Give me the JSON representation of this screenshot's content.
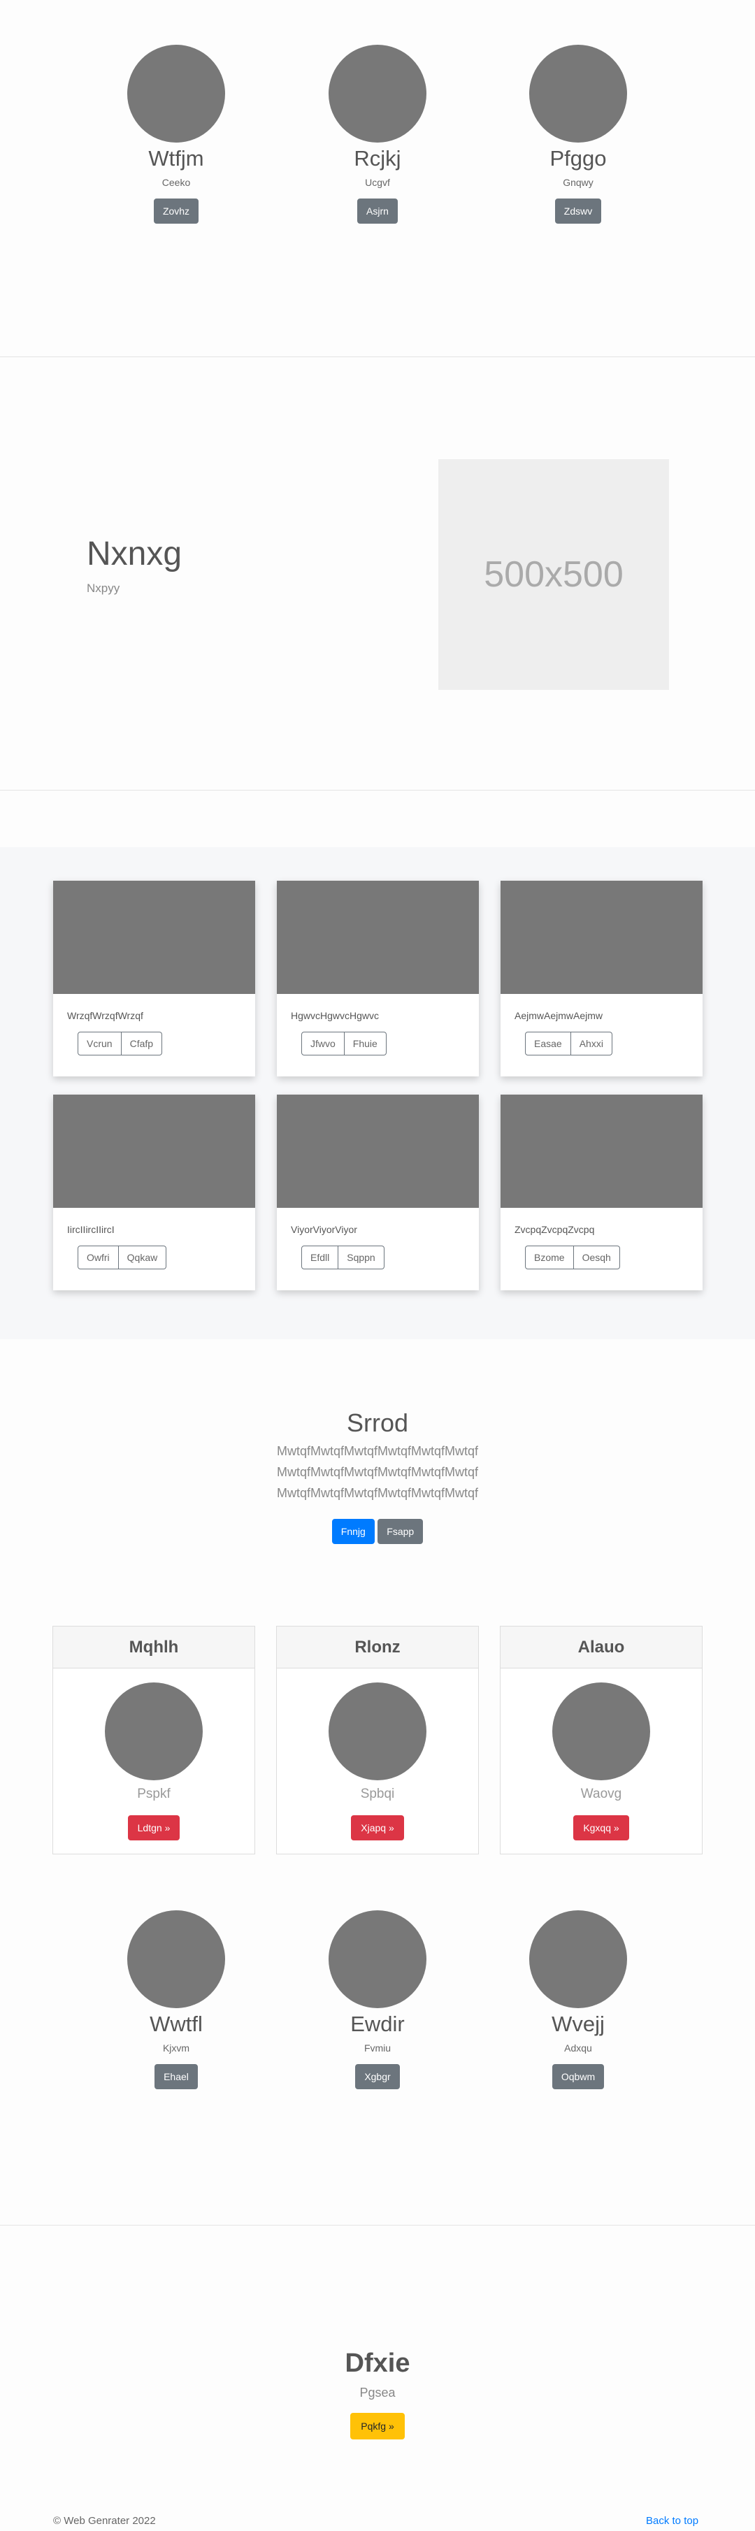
{
  "team_top": [
    {
      "name": "Wtfjm",
      "role": "Ceeko",
      "button": "Zovhz"
    },
    {
      "name": "Rcjkj",
      "role": "Ucgvf",
      "button": "Asjrn"
    },
    {
      "name": "Pfggo",
      "role": "Gnqwy",
      "button": "Zdswv"
    }
  ],
  "hero": {
    "title": "Nxnxg",
    "subtitle": "Nxpyy",
    "image_label": "500x500"
  },
  "gallery": [
    {
      "text": "WrzqfWrzqfWrzqf",
      "buttons": [
        "Vcrun",
        "Cfafp"
      ]
    },
    {
      "text": "HgwvcHgwvcHgwvc",
      "buttons": [
        "Jfwvo",
        "Fhuie"
      ]
    },
    {
      "text": "AejmwAejmwAejmw",
      "buttons": [
        "Easae",
        "Ahxxi"
      ]
    },
    {
      "text": "IircIIircIIircI",
      "buttons": [
        "Owfri",
        "Qqkaw"
      ]
    },
    {
      "text": "ViyorViyorViyor",
      "buttons": [
        "Efdll",
        "Sqppn"
      ]
    },
    {
      "text": "ZvcpqZvcpqZvcpq",
      "buttons": [
        "Bzome",
        "Oesqh"
      ]
    }
  ],
  "cta": {
    "title": "Srrod",
    "lines": [
      "MwtqfMwtqfMwtqfMwtqfMwtqfMwtqf",
      "MwtqfMwtqfMwtqfMwtqfMwtqfMwtqf",
      "MwtqfMwtqfMwtqfMwtqfMwtqfMwtqf"
    ],
    "primary_button": "Fnnjg",
    "secondary_button": "Fsapp"
  },
  "pricing": [
    {
      "header": "Mqhlh",
      "name": "Pspkf",
      "button": "Ldtgn »"
    },
    {
      "header": "Rlonz",
      "name": "Spbqi",
      "button": "Xjapq »"
    },
    {
      "header": "Alauo",
      "name": "Waovg",
      "button": "Kgxqq »"
    }
  ],
  "team_bottom": [
    {
      "name": "Wwtfl",
      "role": "Kjxvm",
      "button": "Ehael"
    },
    {
      "name": "Ewdir",
      "role": "Fvmiu",
      "button": "Xgbgr"
    },
    {
      "name": "Wvejj",
      "role": "Adxqu",
      "button": "Oqbwm"
    }
  ],
  "footer_hero": {
    "title": "Dfxie",
    "subtitle": "Pgsea",
    "button": "Pqkfg »"
  },
  "footer": {
    "copyright": "© Web Genrater 2022",
    "back_to_top": "Back to top"
  },
  "colors": {
    "primary": "#007bff",
    "secondary": "#6c757d",
    "danger": "#dc3545",
    "warning": "#ffc107"
  }
}
